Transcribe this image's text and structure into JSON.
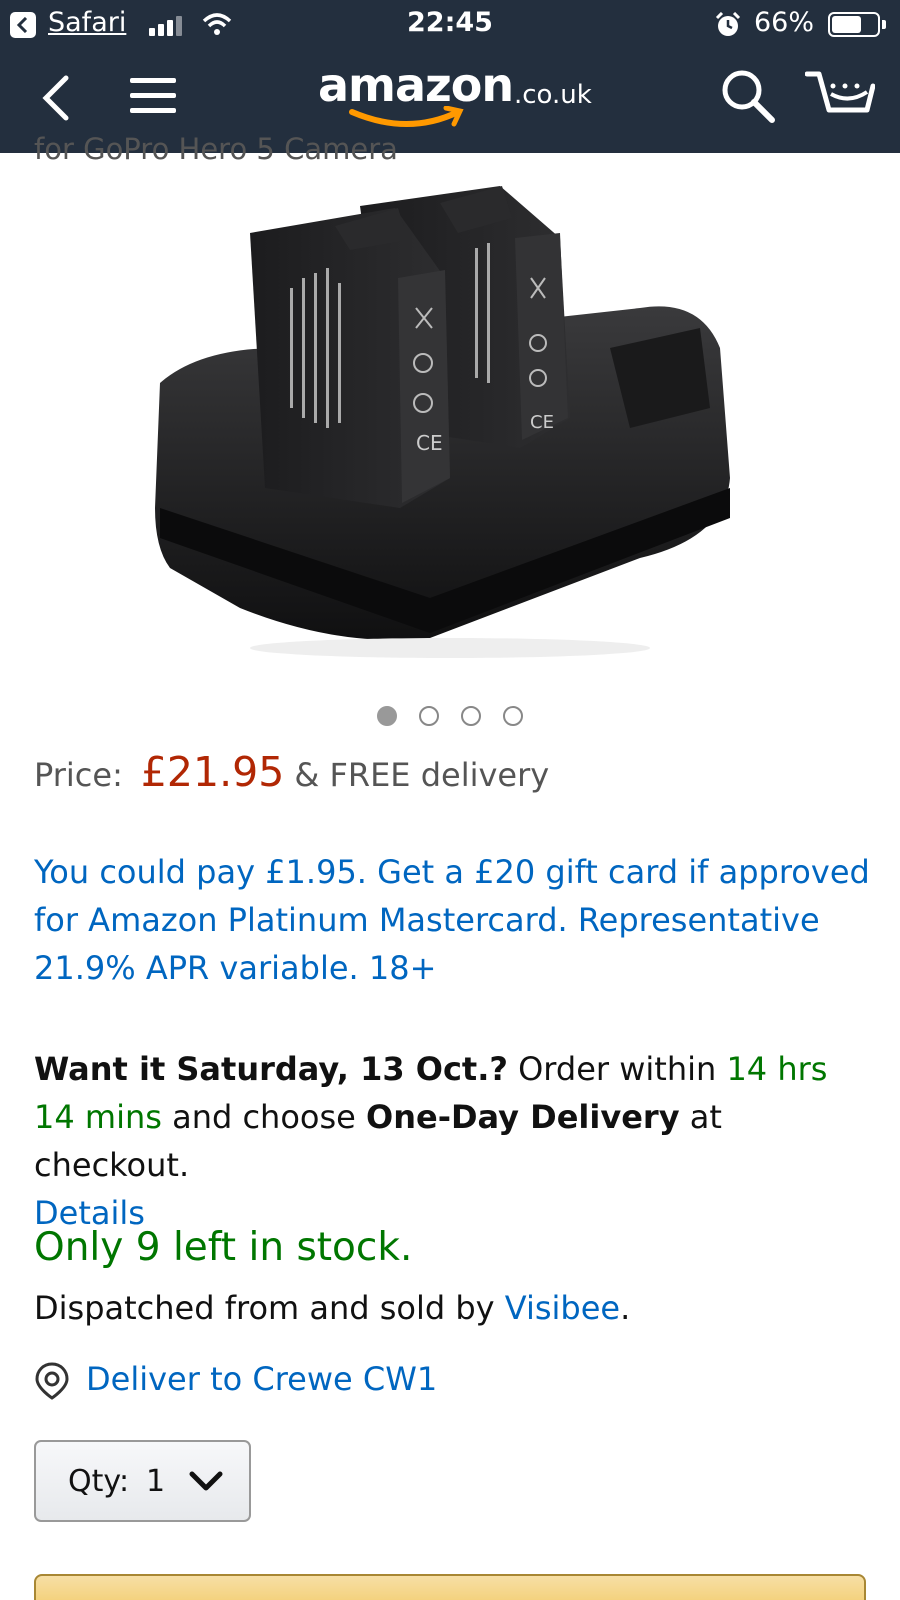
{
  "status_bar": {
    "back_app": "Safari",
    "time": "22:45",
    "battery_percent": "66%",
    "battery_level": 0.66
  },
  "nav": {
    "logo_main": "amazon",
    "logo_tld": ".co.uk"
  },
  "product": {
    "title_fragment": "for GoPro Hero 5 Camera",
    "image_icon": "battery-charger-product-photo",
    "carousel_total": 4,
    "carousel_active": 1
  },
  "price": {
    "label": "Price:",
    "value": "£21.95",
    "delivery": "& FREE delivery"
  },
  "promo": {
    "text": "You could pay £1.95. Get a £20 gift card if approved for Amazon Platinum Mastercard. Representative 21.9% APR variable. 18+"
  },
  "delivery": {
    "want_it": "Want it Saturday, 13 Oct.?",
    "order_within": "Order within",
    "countdown": "14 hrs 14 mins",
    "choose": "and choose",
    "method": "One-Day Delivery",
    "at_checkout": "at checkout.",
    "details_link": "Details"
  },
  "stock": {
    "text": "Only 9 left in stock."
  },
  "seller": {
    "prefix": "Dispatched from and sold by",
    "name": "Visibee",
    "suffix": "."
  },
  "location": {
    "text": "Deliver to Crewe CW1"
  },
  "quantity": {
    "label": "Qty:",
    "value": "1"
  },
  "colors": {
    "header": "#232f3e",
    "price": "#b12704",
    "link": "#0066c0",
    "in_stock": "#007600",
    "logo_smile": "#ff9900",
    "buy_button": "#f0c14b"
  }
}
